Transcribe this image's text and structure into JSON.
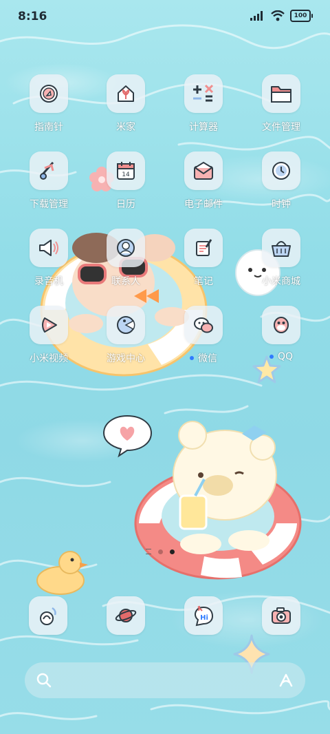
{
  "status_bar": {
    "time": "8:16",
    "battery": "100"
  },
  "apps": [
    {
      "label": "指南针",
      "icon": "compass-icon"
    },
    {
      "label": "米家",
      "icon": "mijia-home-icon"
    },
    {
      "label": "计算器",
      "icon": "calculator-icon"
    },
    {
      "label": "文件管理",
      "icon": "folder-icon"
    },
    {
      "label": "下载管理",
      "icon": "download-icon"
    },
    {
      "label": "日历",
      "icon": "calendar-icon",
      "calendar_day": "14"
    },
    {
      "label": "电子邮件",
      "icon": "mail-icon"
    },
    {
      "label": "时钟",
      "icon": "clock-icon"
    },
    {
      "label": "录音机",
      "icon": "recorder-icon"
    },
    {
      "label": "联系人",
      "icon": "contacts-icon"
    },
    {
      "label": "笔记",
      "icon": "notes-icon"
    },
    {
      "label": "小米商城",
      "icon": "shop-basket-icon"
    },
    {
      "label": "小米视频",
      "icon": "video-icon"
    },
    {
      "label": "游戏中心",
      "icon": "game-center-icon"
    },
    {
      "label": "微信",
      "icon": "wechat-icon",
      "new_badge": true
    },
    {
      "label": "QQ",
      "icon": "qq-icon",
      "new_badge": true
    }
  ],
  "dock": [
    {
      "icon": "phone-icon"
    },
    {
      "icon": "browser-planet-icon"
    },
    {
      "icon": "messages-icon",
      "text": "Hi"
    },
    {
      "icon": "camera-icon"
    }
  ],
  "page_indicator": {
    "pages": 2,
    "active_index": 1
  },
  "colors": {
    "accent": "#2f7bff",
    "water": "#92dde8",
    "tile": "#ebf2f7"
  }
}
